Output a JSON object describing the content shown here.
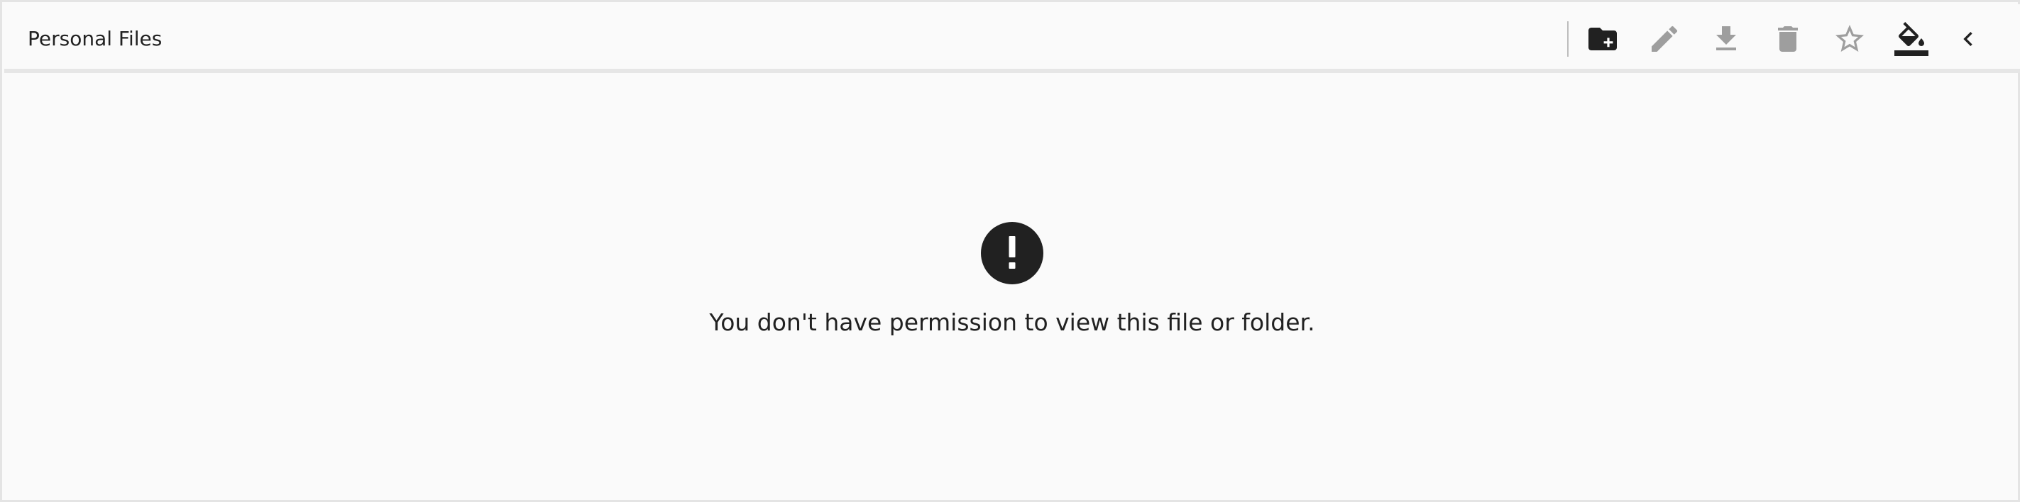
{
  "header": {
    "title": "Personal Files"
  },
  "toolbar": {
    "actions": [
      {
        "name": "create-folder",
        "icon": "create-folder-icon",
        "enabled": true
      },
      {
        "name": "edit",
        "icon": "pencil-icon",
        "enabled": false
      },
      {
        "name": "download",
        "icon": "download-icon",
        "enabled": false
      },
      {
        "name": "delete",
        "icon": "trash-icon",
        "enabled": false
      },
      {
        "name": "favorite",
        "icon": "star-outline-icon",
        "enabled": false
      },
      {
        "name": "theme",
        "icon": "paint-bucket-icon",
        "enabled": true
      },
      {
        "name": "collapse",
        "icon": "chevron-left-icon",
        "enabled": true
      }
    ]
  },
  "main": {
    "alert_icon": "exclamation-circle-icon",
    "message": "You don't have permission to view this file or folder."
  },
  "colors": {
    "active_icon": "#212121",
    "disabled_icon": "#9e9e9e",
    "background": "#fafafa",
    "border": "#e4e4e4"
  }
}
